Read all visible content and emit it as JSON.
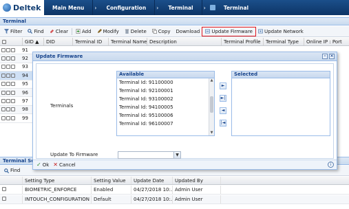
{
  "brand": {
    "name": "Deltek"
  },
  "nav": {
    "items": [
      {
        "label": "Main Menu"
      },
      {
        "label": "Configuration"
      },
      {
        "label": "Terminal"
      },
      {
        "label": "Terminal"
      }
    ]
  },
  "panel": {
    "title": "Terminal"
  },
  "toolbar": {
    "filter": "Filter",
    "find": "Find",
    "clear": "Clear",
    "add": "Add",
    "modify": "Modify",
    "delete": "Delete",
    "copy": "Copy",
    "download": "Download",
    "update_firmware": "Update Firmware",
    "update_network": "Update Network"
  },
  "grid": {
    "columns": [
      "GID ▲",
      "DID",
      "Terminal ID",
      "Terminal Name",
      "Description",
      "Terminal Profile",
      "Terminal Type",
      "Online IP : Port"
    ],
    "rows": [
      {
        "gid": "91"
      },
      {
        "gid": "92"
      },
      {
        "gid": "93"
      },
      {
        "gid": "94"
      },
      {
        "gid": "95"
      },
      {
        "gid": "96"
      },
      {
        "gid": "97"
      },
      {
        "gid": "98"
      },
      {
        "gid": "99"
      }
    ]
  },
  "modal": {
    "title": "Update Firmware",
    "terminals_label": "Terminals",
    "available_header": "Available",
    "selected_header": "Selected",
    "available": [
      "Terminal Id: 91100000",
      "Terminal Id: 92100001",
      "Terminal Id: 93100002",
      "Terminal Id: 94100005",
      "Terminal Id: 95100006",
      "Terminal Id: 96100007"
    ],
    "firmware_label": "Update To Firmware",
    "firmware_value": "",
    "ok": "Ok",
    "cancel": "Cancel"
  },
  "sub_panel": {
    "title": "Terminal Se",
    "find": "Find",
    "columns": [
      "Setting Type",
      "Setting Value",
      "Update Date",
      "Updated By"
    ],
    "rows": [
      {
        "type": "BIOMETRIC_ENFORCE",
        "value": "Enabled",
        "date": "04/27/2018 10:...",
        "by": "Admin User"
      },
      {
        "type": "INTOUCH_CONFIGURATION",
        "value": "Default",
        "date": "04/27/2018 10:...",
        "by": "Admin User"
      }
    ]
  },
  "colors": {
    "nav_bg": "#0d3466",
    "accent": "#15428b",
    "highlight": "#e0141b"
  }
}
